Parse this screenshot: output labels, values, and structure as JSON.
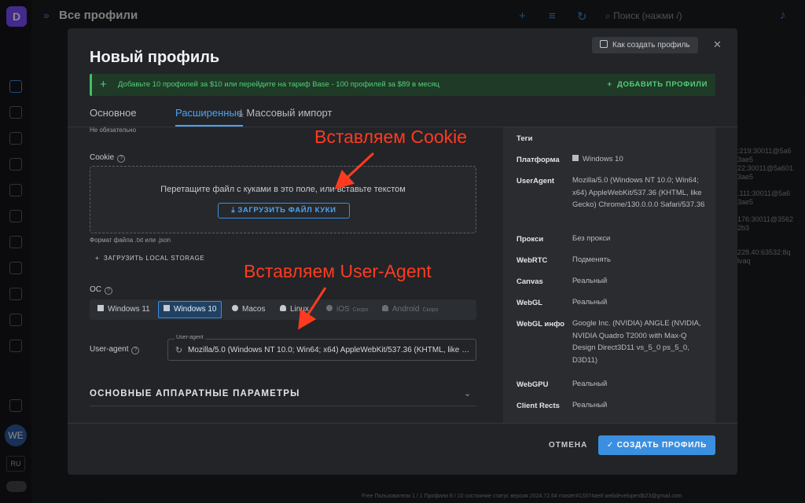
{
  "background": {
    "logo_letter": "D",
    "title": "Все профили",
    "search_placeholder": "Поиск (нажми /)",
    "avatar_initials": "WE",
    "language": "RU",
    "right_snippets": [
      ":219:30011@5a6",
      "3ae5",
      "22:30011@5a601",
      "3ae5",
      ".111:30011@5a6",
      "3ae5",
      "176:30011@3562",
      "2b3",
      "228.40:63532:8q",
      "lvaq"
    ],
    "bottom_status": "Free  Пользователи 1 / 1  Профили 6 / 10  состояние  статус  версия 2024.72.64  master#13374ae8  webdeveloperdb23@gmail.com"
  },
  "modal": {
    "title": "Новый профиль",
    "how_to_label": "Как создать профиль",
    "promo": {
      "text": "Добавьте 10 профилей за $10 или перейдите на тариф Base - 100 профилей за $89 в месяц",
      "button": "ДОБАВИТЬ ПРОФИЛИ"
    },
    "tabs": [
      "Основное",
      "Расширенные",
      "Массовый импорт"
    ],
    "active_tab": "Расширенные",
    "form": {
      "optional_note": "Не обязательно",
      "cookie_label": "Cookie",
      "dropzone_text": "Перетащите файл с куками в это поле, или вставьте текстом",
      "upload_cookie_button": "ЗАГРУЗИТЬ ФАЙЛ КУКИ",
      "file_format_hint": "Формат файла .txt или .json",
      "local_storage_button": "ЗАГРУЗИТЬ LOCAL STORAGE",
      "os_label": "ОС",
      "os_options": [
        {
          "label": "Windows 11",
          "selected": false,
          "disabled": false,
          "soon": ""
        },
        {
          "label": "Windows 10",
          "selected": true,
          "disabled": false,
          "soon": ""
        },
        {
          "label": "Macos",
          "selected": false,
          "disabled": false,
          "soon": ""
        },
        {
          "label": "Linux",
          "selected": false,
          "disabled": false,
          "soon": ""
        },
        {
          "label": "iOS",
          "selected": false,
          "disabled": true,
          "soon": "Скоро"
        },
        {
          "label": "Android",
          "selected": false,
          "disabled": true,
          "soon": "Скоро"
        }
      ],
      "ua_label": "User-agent",
      "ua_legend": "User-agent",
      "ua_value": "Mozilla/5.0 (Windows NT 10.0; Win64; x64) AppleWebKit/537.36 (KHTML, like Gecko) Chrome/130.0.0.0 Safari/537.36",
      "hardware_section": "ОСНОВНЫЕ АППАРАТНЫЕ ПАРАМЕТРЫ"
    },
    "summary": {
      "tags_key": "Теги",
      "platform_key": "Платформа",
      "platform_val": "Windows 10",
      "ua_key": "UserAgent",
      "ua_val": "Mozilla/5.0 (Windows NT 10.0; Win64; x64) AppleWebKit/537.36 (KHTML, like Gecko) Chrome/130.0.0.0 Safari/537.36",
      "proxy_key": "Прокси",
      "proxy_val": "Без прокси",
      "webrtc_key": "WebRTC",
      "webrtc_val": "Подменять",
      "canvas_key": "Canvas",
      "canvas_val": "Реальный",
      "webgl_key": "WebGL",
      "webgl_val": "Реальный",
      "webglinfo_key": "WebGL инфо",
      "webglinfo_val": "Google Inc. (NVIDIA) ANGLE (NVIDIA, NVIDIA Quadro T2000 with Max-Q Design Direct3D11 vs_5_0 ps_5_0, D3D11)",
      "webgpu_key": "WebGPU",
      "webgpu_val": "Реальный",
      "clientrects_key": "Client Rects",
      "clientrects_val": "Реальный"
    },
    "cancel_button": "ОТМЕНА",
    "create_button": "СОЗДАТЬ ПРОФИЛЬ"
  },
  "annotations": {
    "cookie": "Вставляем Cookie",
    "user_agent": "Вставляем User-Agent"
  },
  "colors": {
    "accent": "#3b8fe0",
    "promo": "#4fd07a",
    "annotation": "#ff3b1f"
  }
}
